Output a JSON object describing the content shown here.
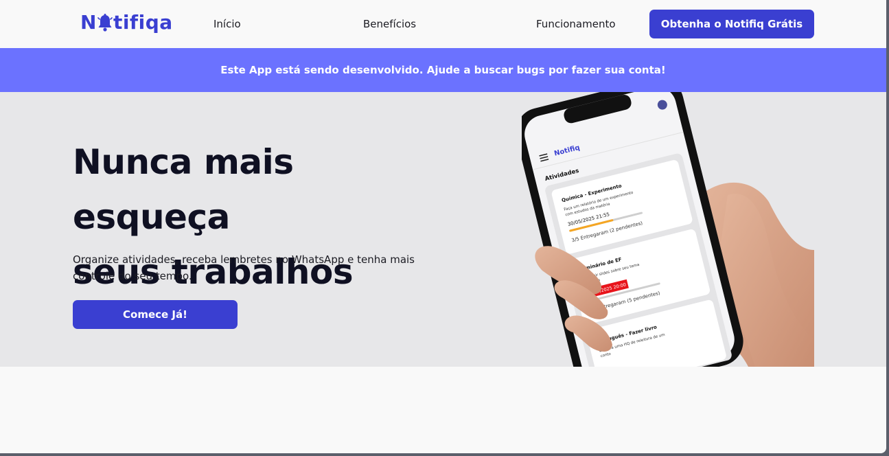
{
  "header": {
    "logo_text_left": "N",
    "logo_text_right": "tifiqa",
    "nav": [
      "Início",
      "Benefícios",
      "Funcionamento"
    ],
    "cta_label": "Obtenha o Notifiq Grátis"
  },
  "banner": {
    "text": "Este App está sendo desenvolvido. Ajude a buscar bugs por fazer sua conta!"
  },
  "hero": {
    "title_line1": "Nunca mais esqueça",
    "title_line2": "seus trabalhos",
    "subtitle": "Organize atividades, receba lembretes no WhatsApp e tenha mais controle do seu tempo.",
    "button_label": "Comece Já!"
  },
  "phone_app": {
    "app_name": "Notifiq",
    "section_title": "Atividades",
    "cards": [
      {
        "title": "Química - Experimento",
        "desc_line1": "Faça um relatório de um experimento",
        "desc_line2": "com estudos da matéria",
        "date": "30/05/2025 21:55",
        "progress_fraction": 0.6,
        "status": "3/5 Entregaram (2 pendentes)",
        "overdue": false
      },
      {
        "title": "Seminário de EF",
        "desc_line1": "Construir slides sobre seu tema",
        "desc_line2": "escolhido",
        "date": "16/05/2025 20:00",
        "progress_fraction": 0.0,
        "status": "0/5 Entregaram (5 pendentes)",
        "overdue": true
      },
      {
        "title": "Português - Fazer livro",
        "desc_line1": "Escreva uma HQ de releitura de um",
        "desc_line2": "conto",
        "date": "",
        "progress_fraction": 0.0,
        "status": "",
        "overdue": false
      }
    ]
  },
  "colors": {
    "brand": "#3a3fd1",
    "banner": "#6b72ff",
    "hero_bg": "#e7e7e9",
    "progress": "#f5a623",
    "overdue": "#e8141b"
  }
}
